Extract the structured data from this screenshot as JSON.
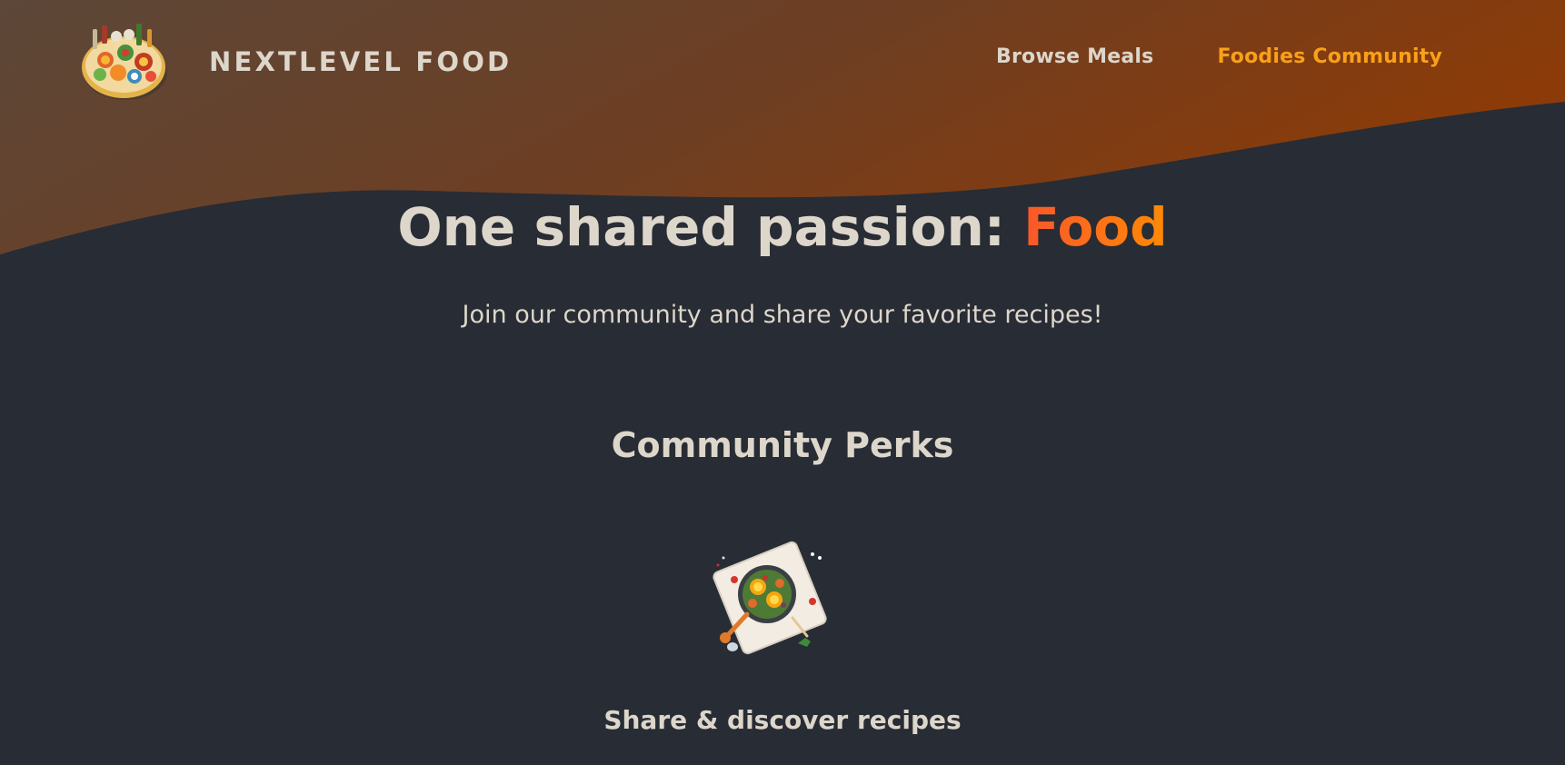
{
  "brand": {
    "name": "NEXTLEVEL FOOD",
    "logo_icon": "food-platter-icon"
  },
  "nav": {
    "items": [
      {
        "label": "Browse Meals",
        "active": false
      },
      {
        "label": "Foodies Community",
        "active": true
      }
    ]
  },
  "hero": {
    "title_prefix": "One shared passion: ",
    "title_highlight": "Food",
    "subtitle": "Join our community and share your favorite recipes!"
  },
  "perks": {
    "title": "Community Perks",
    "items": [
      {
        "icon": "meal-plate-icon",
        "label": "Share & discover recipes"
      }
    ]
  },
  "colors": {
    "background": "#282c34",
    "header_gradient_start": "#5b4637",
    "header_gradient_end": "#8a3a0a",
    "text": "#ddd6cb",
    "accent": "#f9a01b",
    "highlight_start": "#f9572a",
    "highlight_end": "#ff8a05"
  }
}
